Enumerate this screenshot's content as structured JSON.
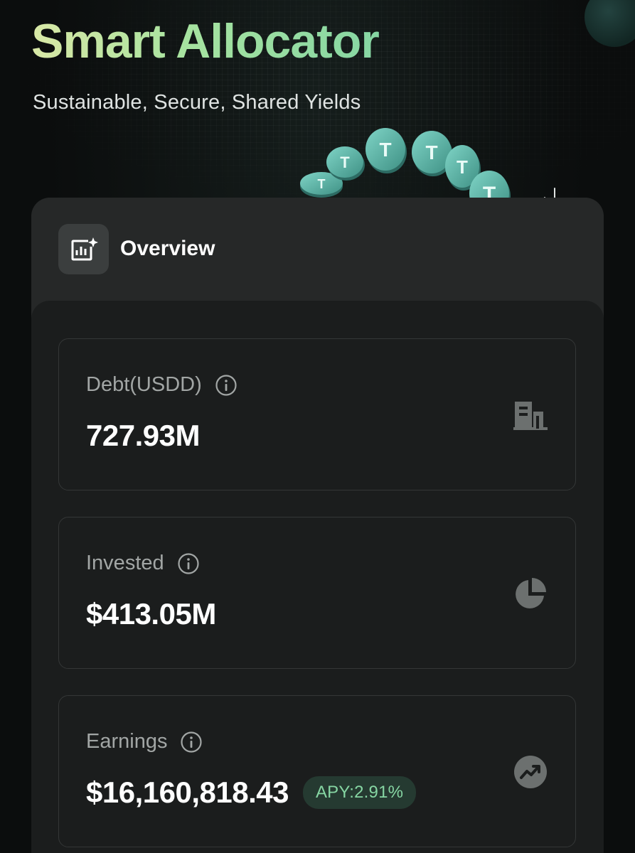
{
  "hero": {
    "title": "Smart Allocator",
    "subtitle": "Sustainable, Secure, Shared Yields"
  },
  "overview": {
    "label": "Overview",
    "icon": "chart-sparkle-icon"
  },
  "stats": [
    {
      "label": "Debt(USDD)",
      "value": "727.93M",
      "icon": "building-icon"
    },
    {
      "label": "Invested",
      "value": "$413.05M",
      "icon": "pie-chart-icon"
    },
    {
      "label": "Earnings",
      "value": "$16,160,818.43",
      "badge": "APY:2.91%",
      "icon": "trend-up-icon"
    }
  ],
  "colors": {
    "background": "#0b0d0d",
    "card": "#262828",
    "panel": "#1b1d1d",
    "accent_green": "#86d6a3",
    "coin_teal": "#4fa69b"
  }
}
